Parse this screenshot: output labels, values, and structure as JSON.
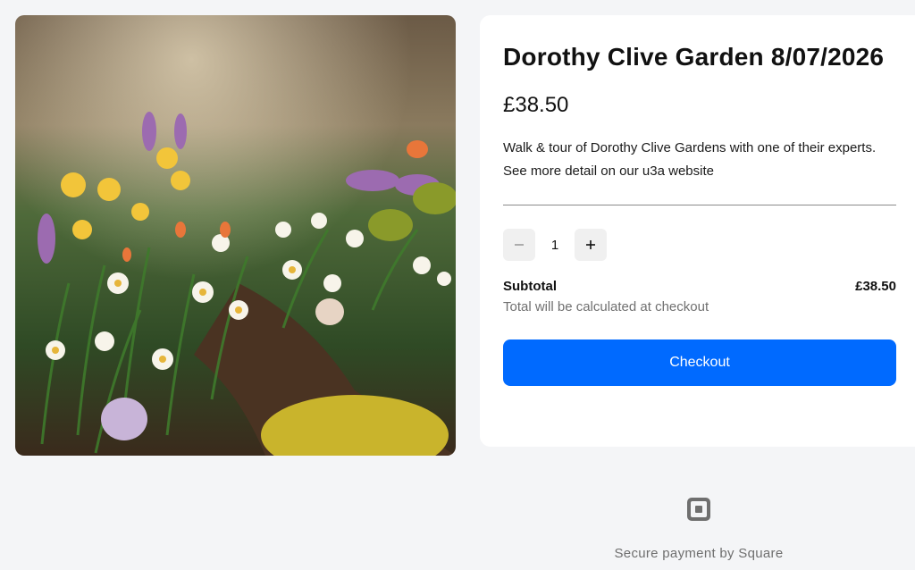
{
  "product": {
    "title": "Dorothy Clive Garden 8/07/2026",
    "price": "£38.50",
    "description": "Walk & tour of Dorothy Clive Gardens with one of their experts. See more detail on our u3a website"
  },
  "quantity": {
    "value": "1",
    "decrease_icon": "minus-icon",
    "increase_icon": "plus-icon"
  },
  "summary": {
    "subtotal_label": "Subtotal",
    "subtotal_value": "£38.50",
    "note": "Total will be calculated at checkout"
  },
  "checkout": {
    "label": "Checkout",
    "color": "#006aff"
  },
  "footer": {
    "text": "Secure payment by Square",
    "logo_icon": "square-logo-icon"
  }
}
